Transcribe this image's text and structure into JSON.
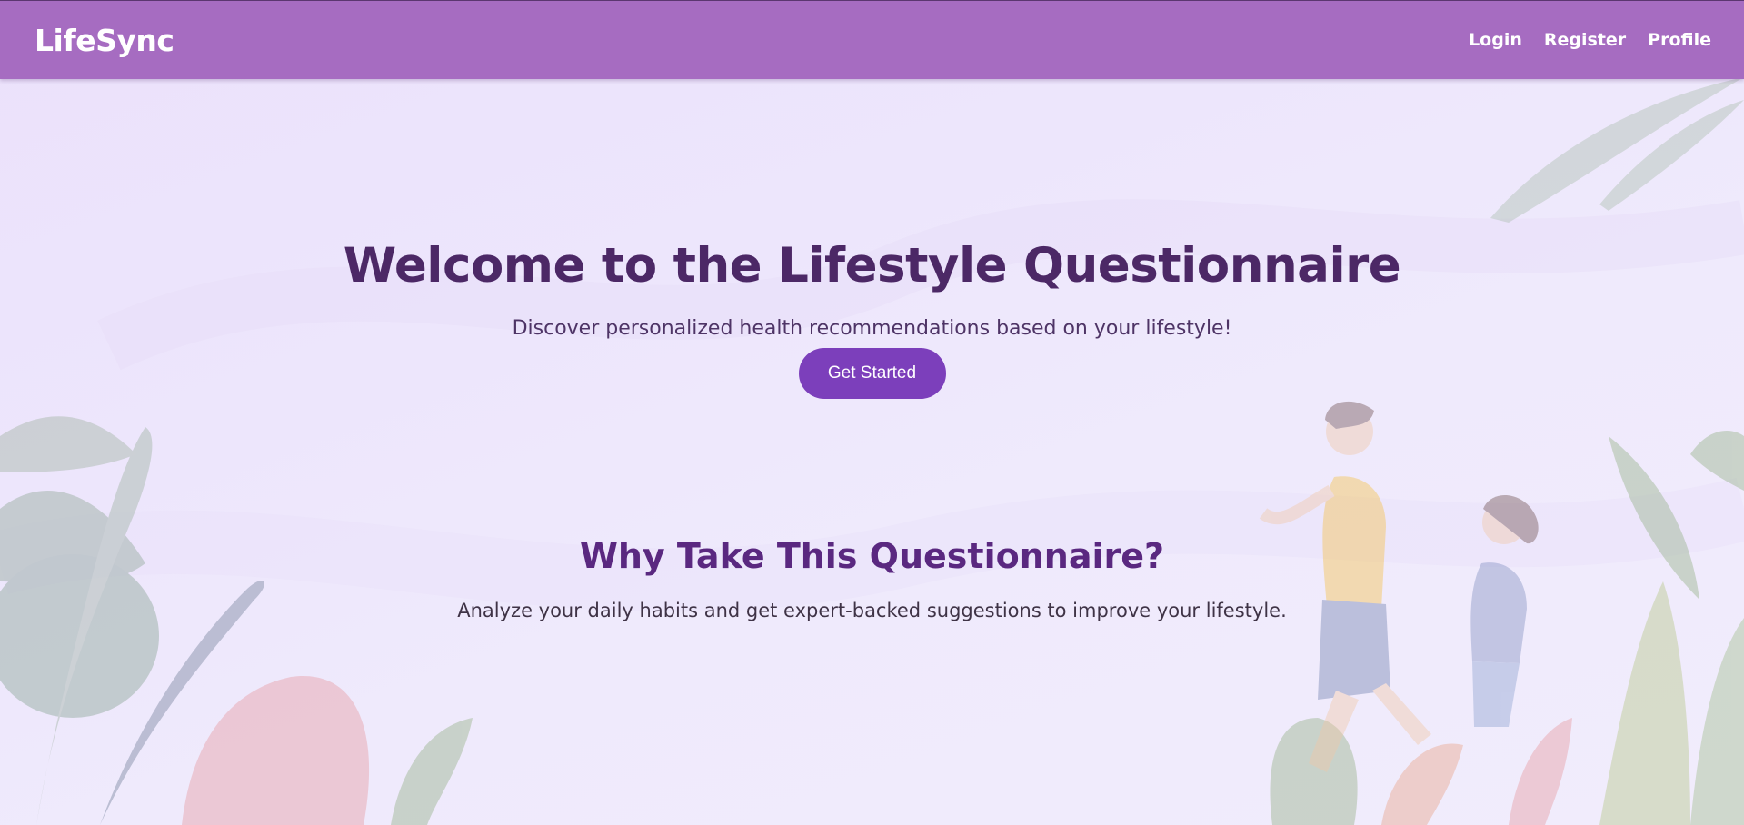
{
  "navbar": {
    "brand": "LifeSync",
    "links": [
      "Login",
      "Register",
      "Profile"
    ]
  },
  "hero": {
    "title": "Welcome to the Lifestyle Questionnaire",
    "subtitle": "Discover personalized health recommendations based on your lifestyle!",
    "cta_label": "Get Started"
  },
  "why": {
    "title": "Why Take This Questionnaire?",
    "text": "Analyze your daily habits and get expert-backed suggestions to improve your lifestyle."
  },
  "colors": {
    "navbar": "#a66cc1",
    "accent": "#7c3fbb",
    "heading": "#4c2866",
    "background": "#ede6fc"
  },
  "illustration": {
    "subject": "two people jogging among leaves and plants",
    "icon": "jogging-illustration"
  }
}
